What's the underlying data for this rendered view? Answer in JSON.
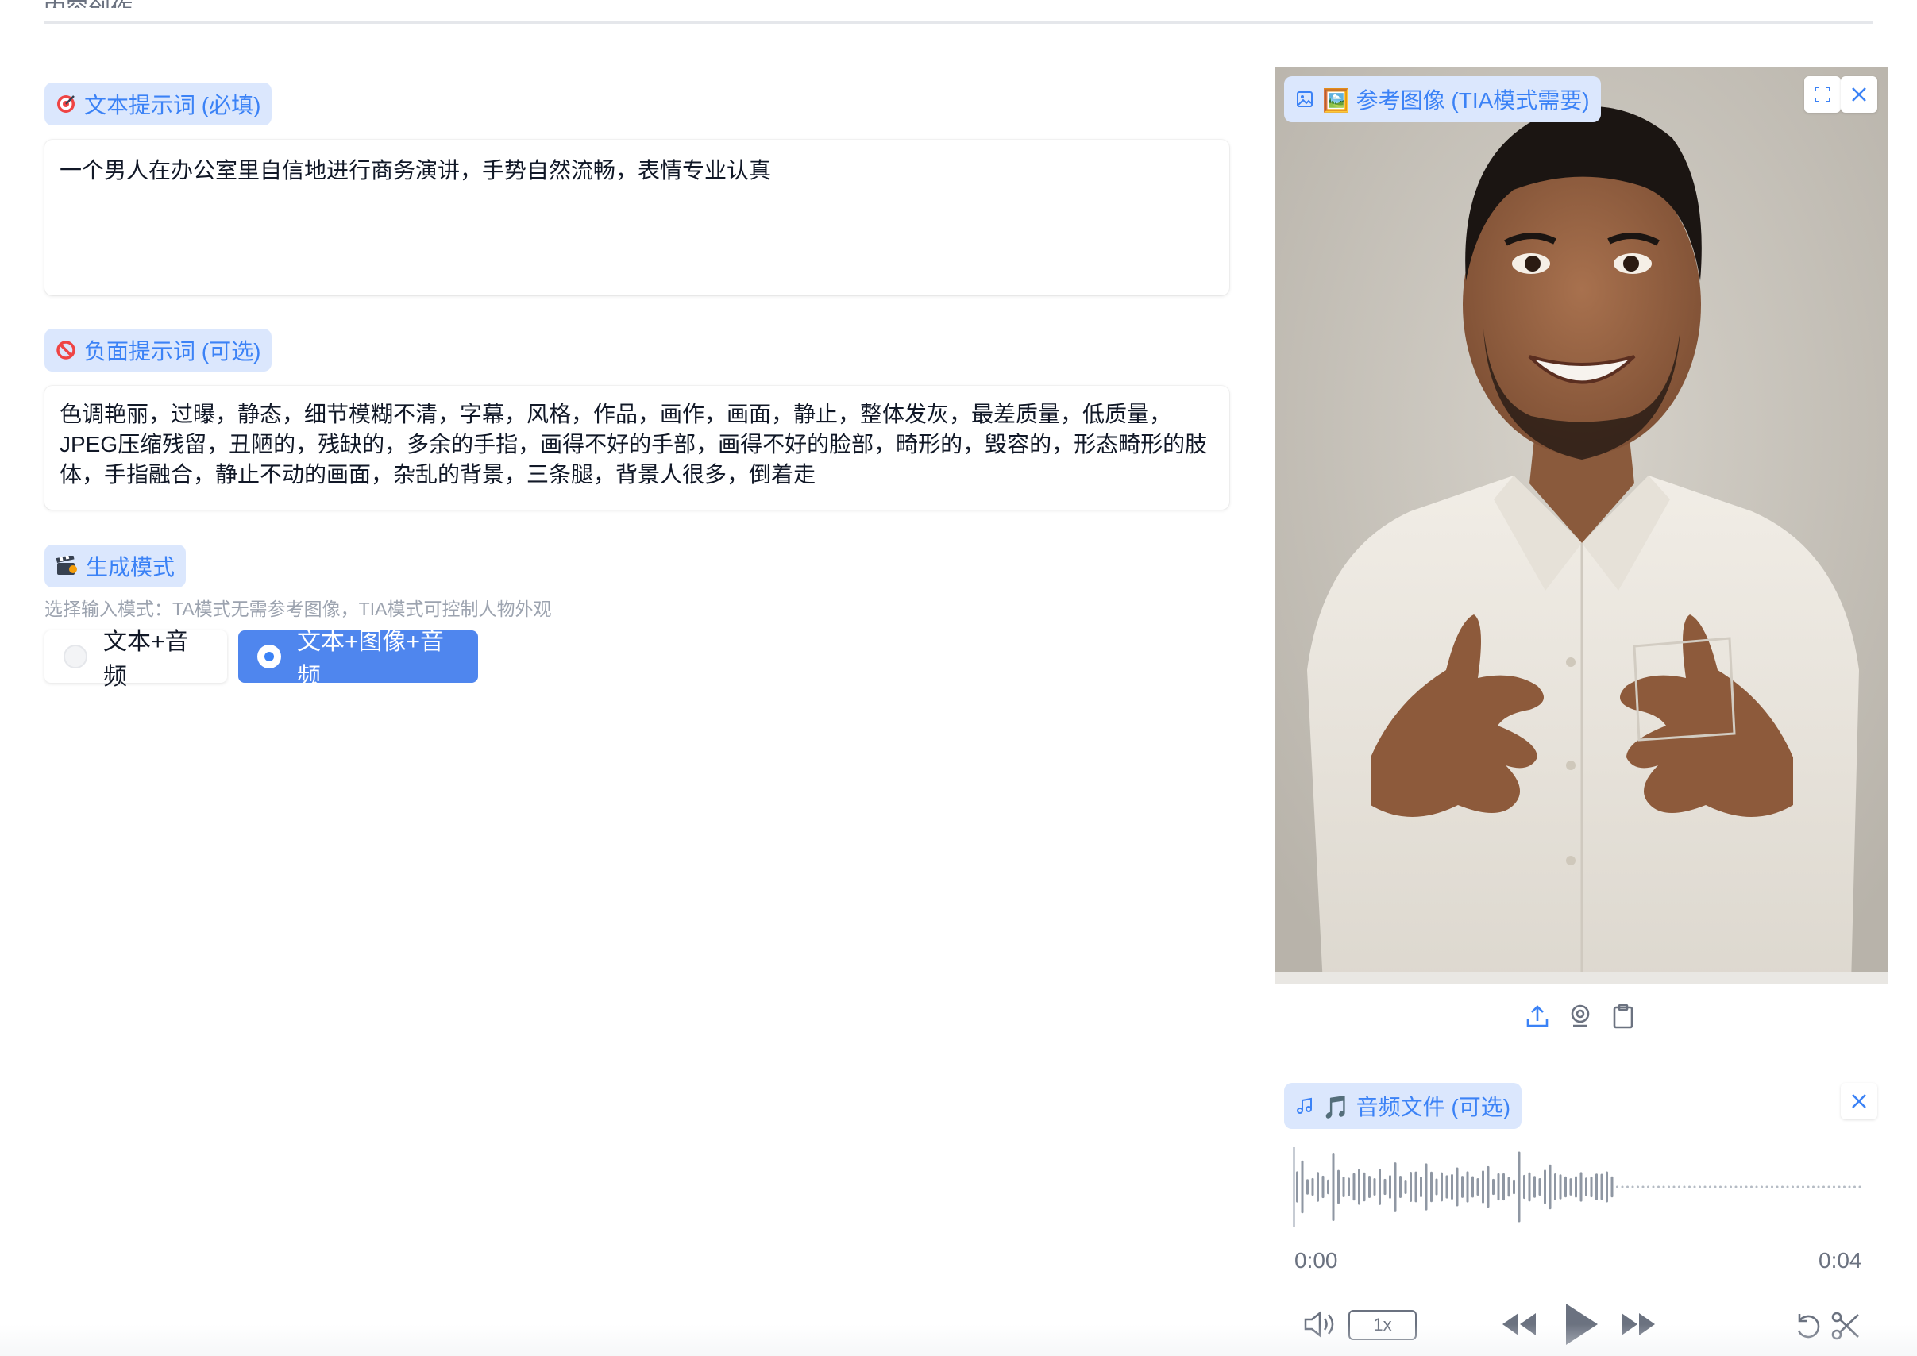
{
  "section": {
    "title": "内容创作"
  },
  "prompt": {
    "label": "文本提示词 (必填)",
    "label_icon": "target-icon",
    "value": "一个男人在办公室里自信地进行商务演讲，手势自然流畅，表情专业认真"
  },
  "negative_prompt": {
    "label": "负面提示词 (可选)",
    "label_icon": "prohibited-icon",
    "value": "色调艳丽，过曝，静态，细节模糊不清，字幕，风格，作品，画作，画面，静止，整体发灰，最差质量，低质量，JPEG压缩残留，丑陋的，残缺的，多余的手指，画得不好的手部，画得不好的脸部，畸形的，毁容的，形态畸形的肢体，手指融合，静止不动的画面，杂乱的背景，三条腿，背景人很多，倒着走"
  },
  "mode": {
    "label": "生成模式",
    "label_icon": "clapperboard-icon",
    "hint": "选择输入模式：TA模式无需参考图像，TIA模式可控制人物外观",
    "options": [
      "文本+音频",
      "文本+图像+音频"
    ],
    "selected": "文本+图像+音频"
  },
  "reference_image": {
    "label": "🖼️ 参考图像 (TIA模式需要)",
    "icons": [
      "image-icon",
      "fullscreen-icon",
      "close-icon",
      "upload-icon",
      "webcam-icon",
      "clipboard-icon"
    ]
  },
  "audio": {
    "label": "🎵 音频文件 (可选)",
    "current_time": "0:00",
    "duration": "0:04",
    "playback_rate": "1x",
    "icons": [
      "music-icon",
      "close-icon",
      "volume-icon",
      "rewind-icon",
      "play-icon",
      "fast-forward-icon",
      "undo-icon",
      "scissors-icon"
    ]
  },
  "colors": {
    "accent": "#3b82f6",
    "chip_bg": "#dbe7fd",
    "selected_radio": "#4f86ee"
  }
}
